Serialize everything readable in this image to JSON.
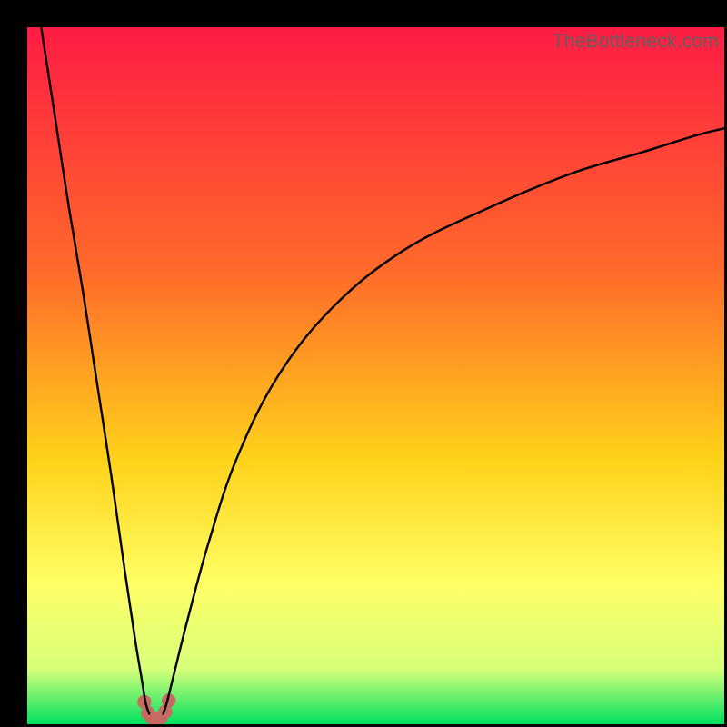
{
  "watermark": "TheBottleneck.com",
  "colors": {
    "frame": "#000000",
    "gradient_top": "#ff1c44",
    "gradient_mid1": "#ff6a2a",
    "gradient_mid2": "#ffd21a",
    "gradient_mid3": "#ffff66",
    "gradient_mid4": "#d8ff7a",
    "gradient_bottom": "#00e060",
    "curve": "#000000",
    "marker": "#c76a62"
  },
  "chart_data": {
    "type": "line",
    "title": "",
    "xlabel": "",
    "ylabel": "",
    "xlim": [
      0,
      100
    ],
    "ylim": [
      0,
      100
    ],
    "grid": false,
    "series": [
      {
        "name": "left-branch",
        "x": [
          2,
          4,
          6,
          8,
          10,
          12,
          14,
          15.5,
          16.5,
          17,
          17.5
        ],
        "y": [
          100,
          87,
          74,
          62,
          49,
          36,
          22,
          12,
          6,
          3,
          1.5
        ]
      },
      {
        "name": "right-branch",
        "x": [
          19.5,
          20,
          21,
          23,
          26,
          30,
          36,
          44,
          54,
          66,
          78,
          88,
          96,
          100
        ],
        "y": [
          1.5,
          3,
          7,
          15,
          26,
          38,
          50,
          60,
          68,
          74,
          79,
          82,
          84.5,
          85.5
        ]
      },
      {
        "name": "valley-marker",
        "x": [
          16.8,
          17.3,
          17.9,
          18.5,
          19.2,
          19.8,
          20.3
        ],
        "y": [
          3.2,
          1.6,
          0.9,
          0.8,
          1.0,
          1.8,
          3.4
        ]
      }
    ],
    "marker_radius_pct": 1.0
  }
}
